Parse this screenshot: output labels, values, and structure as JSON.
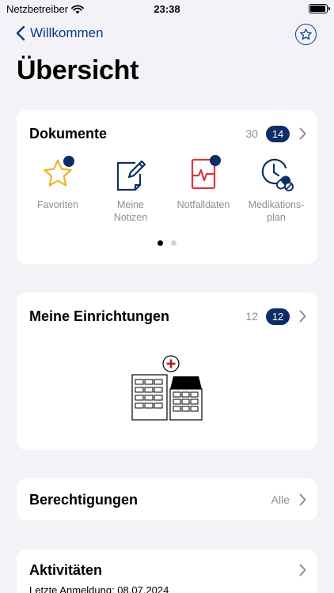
{
  "status": {
    "carrier": "Netzbetreiber",
    "time": "23:38",
    "battery_level": 0.95
  },
  "nav": {
    "back_label": "Willkommen",
    "favorite_icon": "star-icon"
  },
  "page": {
    "title": "Übersicht"
  },
  "documents": {
    "title": "Dokumente",
    "total": "30",
    "badge": "14",
    "items": [
      {
        "label": "Favoriten",
        "icon": "star-icon",
        "has_dot": true,
        "color": "#f0b429"
      },
      {
        "label": "Meine Notizen",
        "icon": "note-edit-icon",
        "has_dot": false,
        "color": "#0b2e66"
      },
      {
        "label": "Notfalldaten",
        "icon": "emergency-data-icon",
        "has_dot": true,
        "color": "#d63a3a"
      },
      {
        "label": "Medikations-plan",
        "icon": "medication-plan-icon",
        "has_dot": false,
        "color": "#0b2e66"
      }
    ],
    "pager": {
      "pages": 2,
      "current": 1
    }
  },
  "facilities": {
    "title": "Meine Einrichtungen",
    "total": "12",
    "badge": "12",
    "illustration": "hospital-buildings-illustration"
  },
  "permissions": {
    "title": "Berechtigungen",
    "value": "Alle"
  },
  "activities": {
    "title": "Aktivitäten",
    "last_login": "Letzte Anmeldung: 08.07.2024"
  },
  "colors": {
    "accent": "#0b2e66",
    "link": "#0b3a8a",
    "background": "#f2f2f7",
    "muted": "#8e8e93"
  }
}
